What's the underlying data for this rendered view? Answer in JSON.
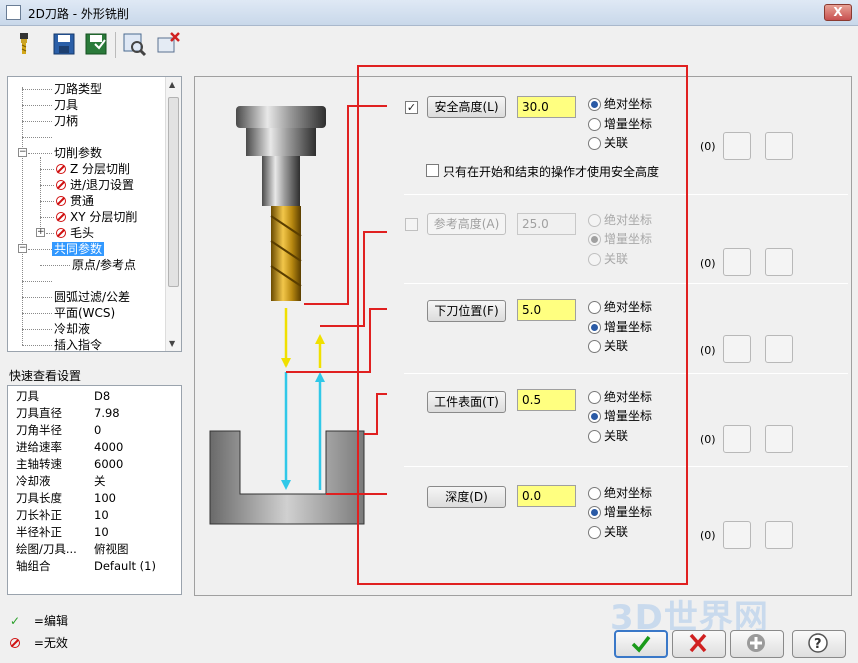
{
  "window": {
    "title": "2D刀路 - 外形铣削",
    "close_label": "X"
  },
  "toolbar": {
    "icons": [
      "tool-icon",
      "save-icon",
      "save-as-icon",
      "preview-icon",
      "delete-icon"
    ]
  },
  "tree": {
    "items": [
      {
        "label": "刀路类型"
      },
      {
        "label": "刀具"
      },
      {
        "label": "刀柄"
      },
      {
        "label": ""
      },
      {
        "label": "切削参数"
      },
      {
        "label": "Z 分层切削"
      },
      {
        "label": "进/退刀设置"
      },
      {
        "label": "贯通"
      },
      {
        "label": "XY 分层切削"
      },
      {
        "label": "毛头"
      },
      {
        "label": "共同参数"
      },
      {
        "label": "原点/参考点"
      },
      {
        "label": ""
      },
      {
        "label": "圆弧过滤/公差"
      },
      {
        "label": "平面(WCS)"
      },
      {
        "label": "冷却液"
      },
      {
        "label": "插入指令"
      }
    ]
  },
  "quickview": {
    "title": "快速查看设置",
    "rows": [
      {
        "k": "刀具",
        "v": "D8"
      },
      {
        "k": "刀具直径",
        "v": "7.98"
      },
      {
        "k": "刀角半径",
        "v": "0"
      },
      {
        "k": "进给速率",
        "v": "4000"
      },
      {
        "k": "主轴转速",
        "v": "6000"
      },
      {
        "k": "冷却液",
        "v": "关"
      },
      {
        "k": "刀具长度",
        "v": "100"
      },
      {
        "k": "刀长补正",
        "v": "10"
      },
      {
        "k": "半径补正",
        "v": "10"
      },
      {
        "k": "绘图/刀具...",
        "v": "俯视图"
      },
      {
        "k": "轴组合",
        "v": "Default (1)"
      }
    ]
  },
  "legend": {
    "edit": "=编辑",
    "invalid": "=无效"
  },
  "params": {
    "safety": {
      "label": "安全高度(L)",
      "value": "30.0",
      "checked": true,
      "only_label": "只有在开始和结束的操作才使用安全高度"
    },
    "reference": {
      "label": "参考高度(A)",
      "value": "25.0"
    },
    "feed_plane": {
      "label": "下刀位置(F)",
      "value": "5.0"
    },
    "top_stock": {
      "label": "工件表面(T)",
      "value": "0.5"
    },
    "depth": {
      "label": "深度(D)",
      "value": "0.0"
    },
    "radio": {
      "absolute": "绝对坐标",
      "incremental": "增量坐标",
      "associative": "关联"
    },
    "count": "(0)"
  },
  "footer": {
    "watermark": "3D世界网"
  }
}
